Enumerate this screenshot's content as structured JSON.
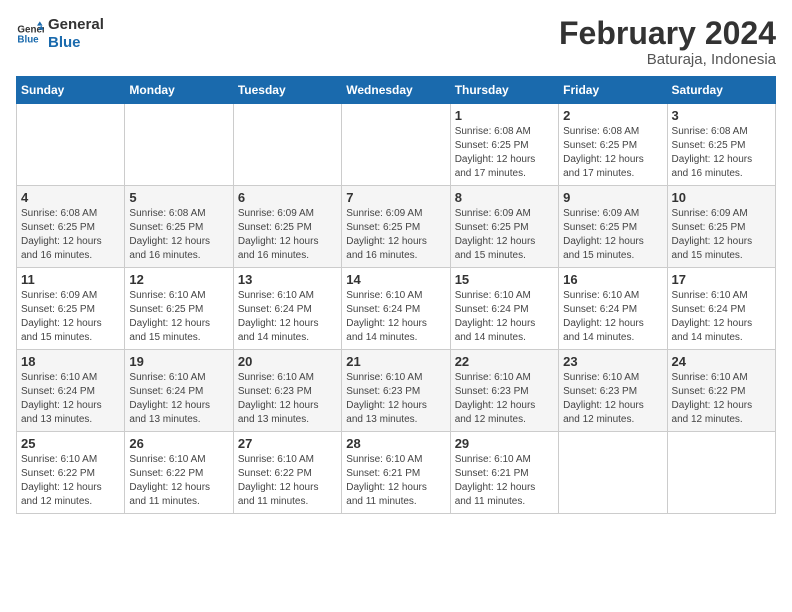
{
  "logo": {
    "line1": "General",
    "line2": "Blue"
  },
  "title": "February 2024",
  "location": "Baturaja, Indonesia",
  "header_days": [
    "Sunday",
    "Monday",
    "Tuesday",
    "Wednesday",
    "Thursday",
    "Friday",
    "Saturday"
  ],
  "weeks": [
    [
      {
        "day": "",
        "info": ""
      },
      {
        "day": "",
        "info": ""
      },
      {
        "day": "",
        "info": ""
      },
      {
        "day": "",
        "info": ""
      },
      {
        "day": "1",
        "info": "Sunrise: 6:08 AM\nSunset: 6:25 PM\nDaylight: 12 hours and 17 minutes."
      },
      {
        "day": "2",
        "info": "Sunrise: 6:08 AM\nSunset: 6:25 PM\nDaylight: 12 hours and 17 minutes."
      },
      {
        "day": "3",
        "info": "Sunrise: 6:08 AM\nSunset: 6:25 PM\nDaylight: 12 hours and 16 minutes."
      }
    ],
    [
      {
        "day": "4",
        "info": "Sunrise: 6:08 AM\nSunset: 6:25 PM\nDaylight: 12 hours and 16 minutes."
      },
      {
        "day": "5",
        "info": "Sunrise: 6:08 AM\nSunset: 6:25 PM\nDaylight: 12 hours and 16 minutes."
      },
      {
        "day": "6",
        "info": "Sunrise: 6:09 AM\nSunset: 6:25 PM\nDaylight: 12 hours and 16 minutes."
      },
      {
        "day": "7",
        "info": "Sunrise: 6:09 AM\nSunset: 6:25 PM\nDaylight: 12 hours and 16 minutes."
      },
      {
        "day": "8",
        "info": "Sunrise: 6:09 AM\nSunset: 6:25 PM\nDaylight: 12 hours and 15 minutes."
      },
      {
        "day": "9",
        "info": "Sunrise: 6:09 AM\nSunset: 6:25 PM\nDaylight: 12 hours and 15 minutes."
      },
      {
        "day": "10",
        "info": "Sunrise: 6:09 AM\nSunset: 6:25 PM\nDaylight: 12 hours and 15 minutes."
      }
    ],
    [
      {
        "day": "11",
        "info": "Sunrise: 6:09 AM\nSunset: 6:25 PM\nDaylight: 12 hours and 15 minutes."
      },
      {
        "day": "12",
        "info": "Sunrise: 6:10 AM\nSunset: 6:25 PM\nDaylight: 12 hours and 15 minutes."
      },
      {
        "day": "13",
        "info": "Sunrise: 6:10 AM\nSunset: 6:24 PM\nDaylight: 12 hours and 14 minutes."
      },
      {
        "day": "14",
        "info": "Sunrise: 6:10 AM\nSunset: 6:24 PM\nDaylight: 12 hours and 14 minutes."
      },
      {
        "day": "15",
        "info": "Sunrise: 6:10 AM\nSunset: 6:24 PM\nDaylight: 12 hours and 14 minutes."
      },
      {
        "day": "16",
        "info": "Sunrise: 6:10 AM\nSunset: 6:24 PM\nDaylight: 12 hours and 14 minutes."
      },
      {
        "day": "17",
        "info": "Sunrise: 6:10 AM\nSunset: 6:24 PM\nDaylight: 12 hours and 14 minutes."
      }
    ],
    [
      {
        "day": "18",
        "info": "Sunrise: 6:10 AM\nSunset: 6:24 PM\nDaylight: 12 hours and 13 minutes."
      },
      {
        "day": "19",
        "info": "Sunrise: 6:10 AM\nSunset: 6:24 PM\nDaylight: 12 hours and 13 minutes."
      },
      {
        "day": "20",
        "info": "Sunrise: 6:10 AM\nSunset: 6:23 PM\nDaylight: 12 hours and 13 minutes."
      },
      {
        "day": "21",
        "info": "Sunrise: 6:10 AM\nSunset: 6:23 PM\nDaylight: 12 hours and 13 minutes."
      },
      {
        "day": "22",
        "info": "Sunrise: 6:10 AM\nSunset: 6:23 PM\nDaylight: 12 hours and 12 minutes."
      },
      {
        "day": "23",
        "info": "Sunrise: 6:10 AM\nSunset: 6:23 PM\nDaylight: 12 hours and 12 minutes."
      },
      {
        "day": "24",
        "info": "Sunrise: 6:10 AM\nSunset: 6:22 PM\nDaylight: 12 hours and 12 minutes."
      }
    ],
    [
      {
        "day": "25",
        "info": "Sunrise: 6:10 AM\nSunset: 6:22 PM\nDaylight: 12 hours and 12 minutes."
      },
      {
        "day": "26",
        "info": "Sunrise: 6:10 AM\nSunset: 6:22 PM\nDaylight: 12 hours and 11 minutes."
      },
      {
        "day": "27",
        "info": "Sunrise: 6:10 AM\nSunset: 6:22 PM\nDaylight: 12 hours and 11 minutes."
      },
      {
        "day": "28",
        "info": "Sunrise: 6:10 AM\nSunset: 6:21 PM\nDaylight: 12 hours and 11 minutes."
      },
      {
        "day": "29",
        "info": "Sunrise: 6:10 AM\nSunset: 6:21 PM\nDaylight: 12 hours and 11 minutes."
      },
      {
        "day": "",
        "info": ""
      },
      {
        "day": "",
        "info": ""
      }
    ]
  ]
}
